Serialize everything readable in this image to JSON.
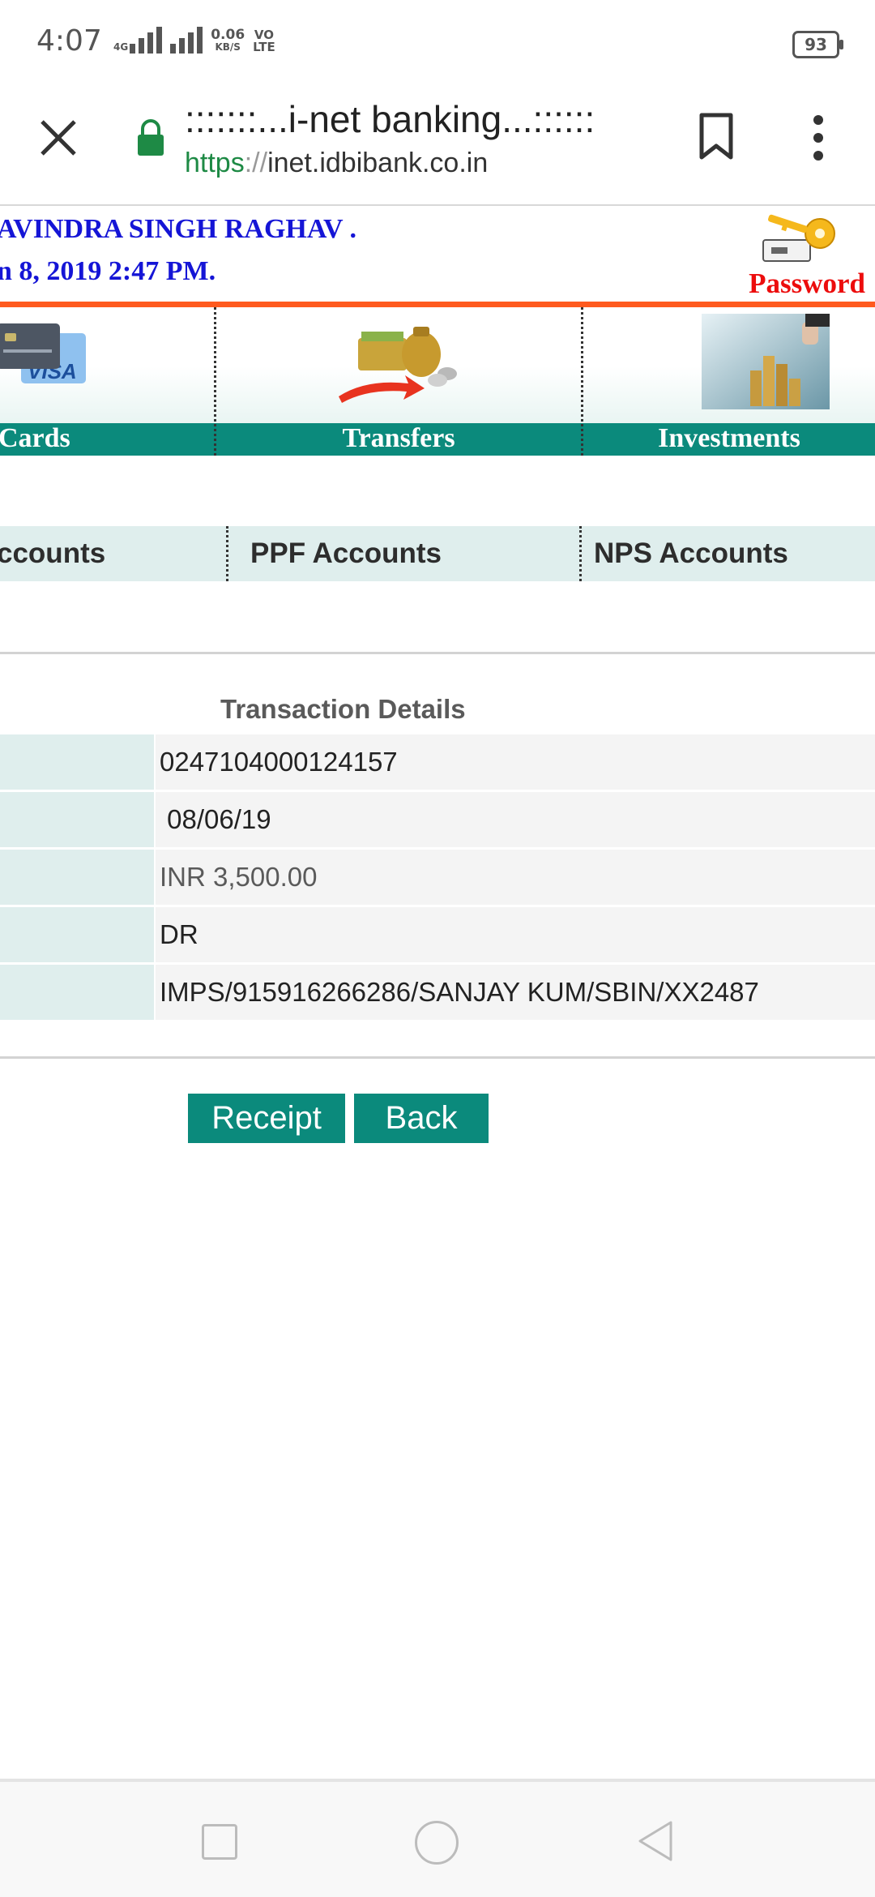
{
  "status_bar": {
    "time": "4:07",
    "network_type": "4G",
    "data_speed": "0.06",
    "data_unit": "KB/S",
    "volte_top": "VO",
    "volte_bottom": "LTE",
    "battery": "93"
  },
  "browser": {
    "page_title": ":::::::...i-net banking...::::::",
    "url_scheme": "https",
    "url_sep": "://",
    "url_host": "inet.idbibank.co.in",
    "icons": [
      "close-icon",
      "lock-icon",
      "bookmark-icon",
      "more-vert-icon"
    ]
  },
  "bank_header": {
    "welcome_name": "AVINDRA SINGH RAGHAV .",
    "welcome_date": "n 8, 2019 2:47 PM.",
    "password_label": "Password"
  },
  "main_menu": {
    "items": [
      {
        "label": "Cards",
        "icon": "visa-card-icon"
      },
      {
        "label": "Transfers",
        "icon": "money-transfer-icon"
      },
      {
        "label": "Investments",
        "icon": "coins-investment-icon"
      }
    ]
  },
  "sub_menu": {
    "items": [
      {
        "label": "ccounts"
      },
      {
        "label": "PPF Accounts"
      },
      {
        "label": "NPS Accounts"
      }
    ]
  },
  "transaction": {
    "title": "Transaction Details",
    "rows": [
      {
        "value": "0247104000124157"
      },
      {
        "value": " 08/06/19"
      },
      {
        "value": "INR 3,500.00"
      },
      {
        "value": "DR"
      },
      {
        "value": "IMPS/915916266286/SANJAY KUM/SBIN/XX2487"
      }
    ]
  },
  "buttons": {
    "receipt": "Receipt",
    "back": "Back"
  },
  "colors": {
    "teal": "#0b8a7c",
    "orange_rule": "#ff5a1e",
    "header_blue": "#1515d6",
    "password_red": "#ec0d0d",
    "secure_green": "#1e8a45"
  },
  "nav_bar": {
    "icons": [
      "recents-square-icon",
      "home-circle-icon",
      "back-triangle-icon"
    ]
  }
}
